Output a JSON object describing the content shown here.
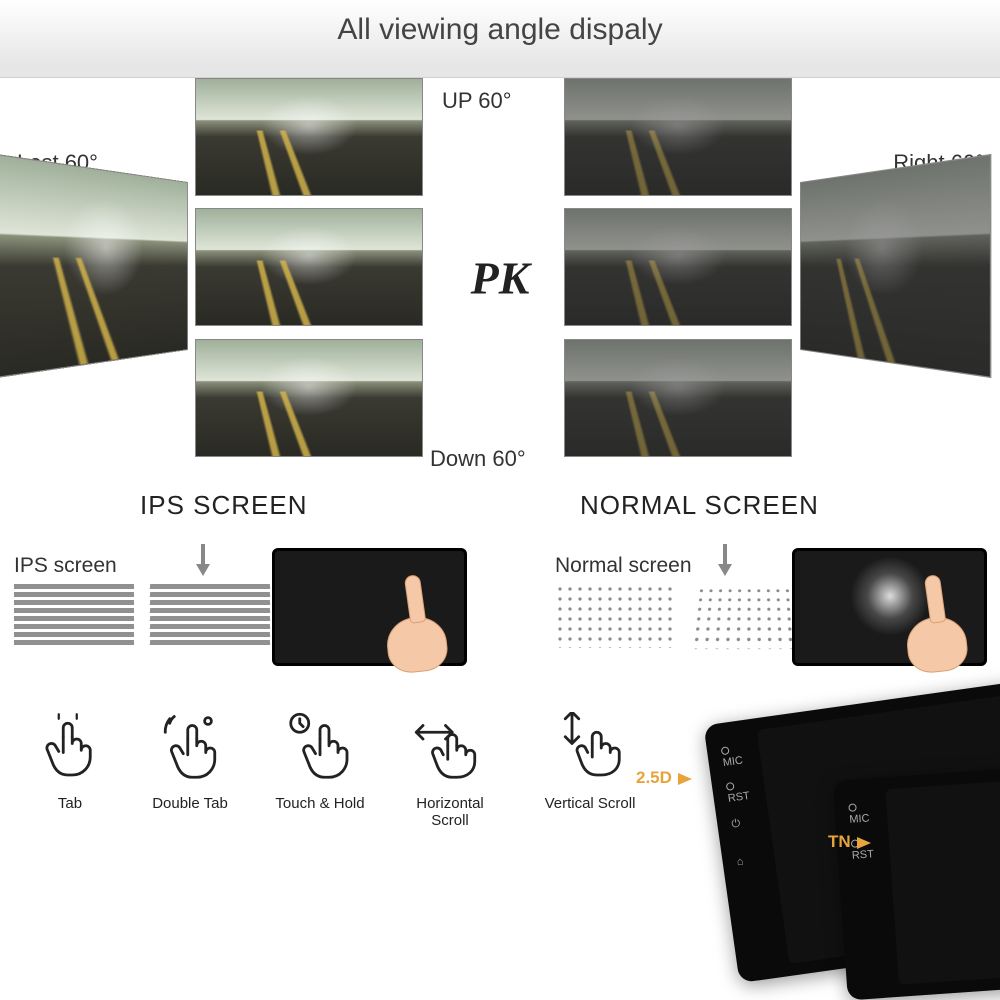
{
  "header": {
    "title": "All viewing angle dispaly"
  },
  "angles": {
    "up": "UP 60°",
    "down": "Down 60°",
    "left": "Lest 60°",
    "right": "Right 60°",
    "versus": "PK"
  },
  "screen_types": {
    "ips_heading": "IPS SCREEN",
    "normal_heading": "NORMAL SCREEN",
    "ips_sub": "IPS screen",
    "normal_sub": "Normal screen"
  },
  "gestures": [
    {
      "label": "Tab"
    },
    {
      "label": "Double Tab"
    },
    {
      "label": "Touch & Hold"
    },
    {
      "label": "Horizontal Scroll"
    },
    {
      "label": "Vertical Scroll"
    }
  ],
  "device_buttons": {
    "mic": "MIC",
    "rst": "RST"
  },
  "callouts": {
    "curved": "2.5D",
    "panel": "TN"
  }
}
